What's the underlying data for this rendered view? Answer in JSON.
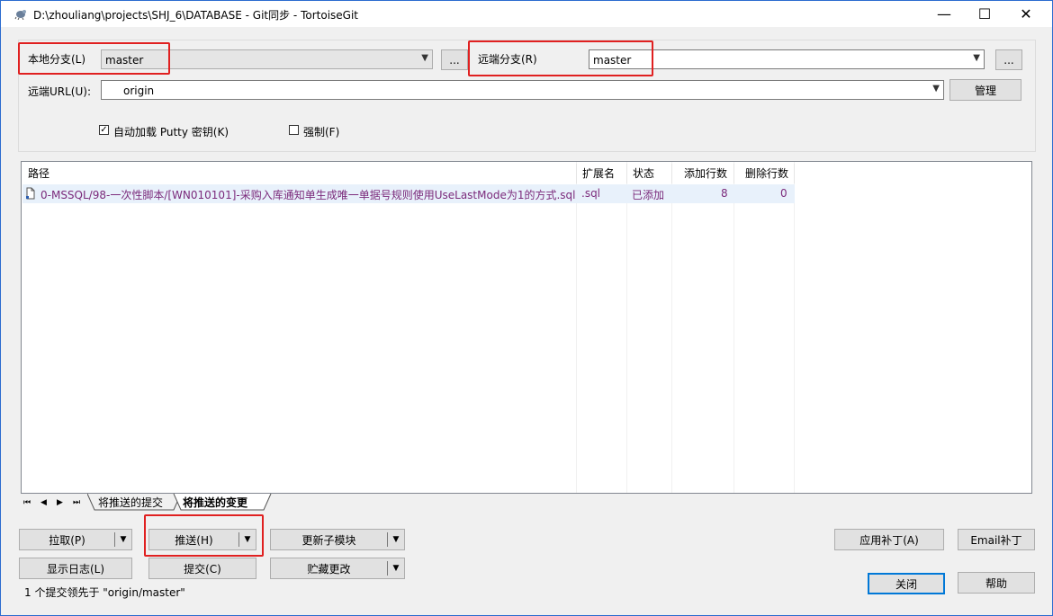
{
  "window": {
    "title": "D:\\zhouliang\\projects\\SHJ_6\\DATABASE - Git同步 - TortoiseGit",
    "controls": {
      "minimize": "—",
      "maximize": "☐",
      "close": "✕"
    }
  },
  "branch": {
    "local_label": "本地分支(L)",
    "local_value": "master",
    "local_browse": "...",
    "remote_label": "远端分支(R)",
    "remote_value": "master",
    "remote_browse": "...",
    "url_label": "远端URL(U):",
    "url_value": "origin",
    "manage_button": "管理"
  },
  "options": {
    "autoload_label": "自动加载 Putty 密钥(K)",
    "autoload_checked": true,
    "force_label": "强制(F)",
    "force_checked": false
  },
  "table": {
    "columns": [
      "路径",
      "扩展名",
      "状态",
      "添加行数",
      "删除行数"
    ],
    "rows": [
      {
        "path": "0-MSSQL/98-一次性脚本/[WN010101]-采购入库通知单生成唯一单据号规则使用UseLastMode为1的方式.sql",
        "ext": ".sql",
        "status": "已添加",
        "added": "8",
        "deleted": "0"
      }
    ]
  },
  "tabs": {
    "nav": [
      "⏮",
      "◀",
      "▶",
      "⏭"
    ],
    "items": [
      "将推送的提交",
      "将推送的变更"
    ],
    "active": 1
  },
  "buttons": {
    "pull": "拉取(P)",
    "push": "推送(H)",
    "update_submodules": "更新子模块",
    "show_log": "显示日志(L)",
    "commit": "提交(C)",
    "stash": "贮藏更改",
    "apply_patch": "应用补丁(A)",
    "email_patch": "Email补丁",
    "close": "关闭",
    "help": "帮助"
  },
  "status": {
    "message": "1 个提交领先于 \"origin/master\""
  },
  "colors": {
    "highlight_red": "#e02020",
    "file_text": "#7b2a7b",
    "selection": "#e8f1fb",
    "window_bg": "#f0f0f0"
  }
}
